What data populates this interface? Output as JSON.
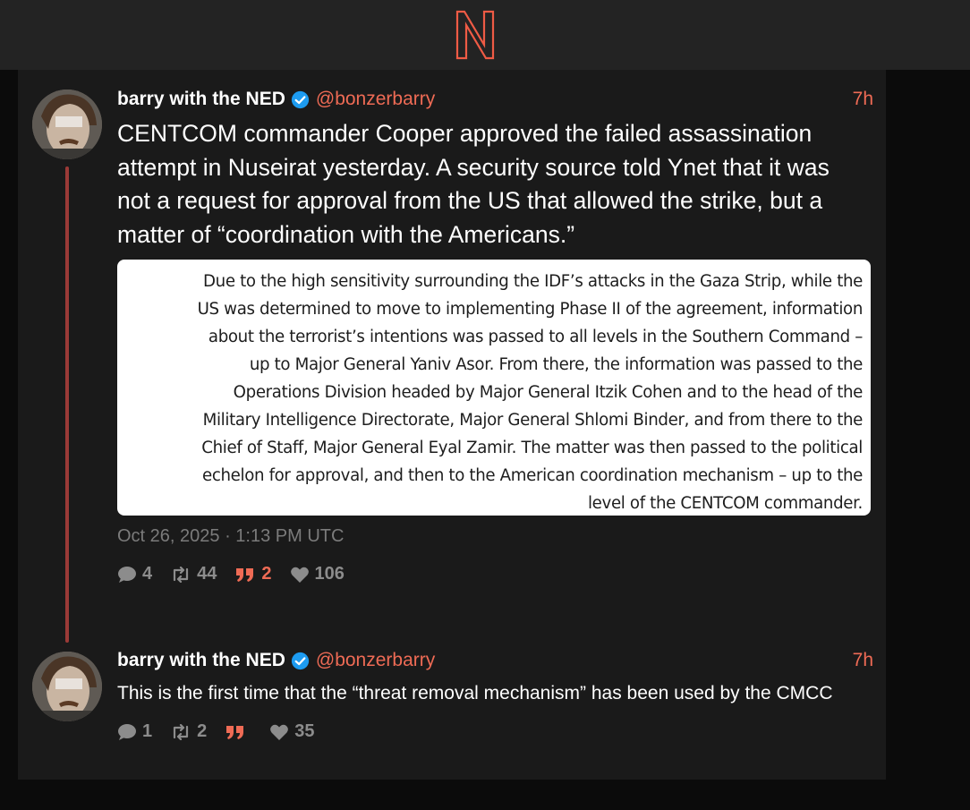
{
  "header": {
    "logo": "N"
  },
  "posts": [
    {
      "author": "barry with the NED",
      "handle": "@bonzerbarry",
      "time": "7h",
      "text": "CENTCOM commander Cooper approved the failed assassination attempt in Nuseirat yesterday. A security source told Ynet that it was not a request for approval from the US that allowed the strike, but a matter of “coordination with the Americans.”",
      "quote_lines": [
        "Due to the high sensitivity surrounding the IDF’s attacks in the Gaza Strip, while the",
        "US was determined to move to implementing Phase II of the agreement, information",
        "about the terrorist’s intentions was passed to all levels in the Southern Command –",
        "up to Major General Yaniv Asor. From there, the information was passed to the",
        "Operations Division headed by Major General Itzik Cohen and to the head of the",
        "Military Intelligence Directorate, Major General Shlomi Binder, and from there to the",
        "Chief of Staff, Major General Eyal Zamir. The matter was then passed to the political",
        "echelon for approval, and then to the American coordination mechanism – up to the",
        "level of the CENTCOM commander."
      ],
      "timestamp": "Oct 26, 2025 · 1:13 PM UTC",
      "stats": {
        "replies": "4",
        "reposts": "44",
        "quotes": "2",
        "likes": "106"
      }
    },
    {
      "author": "barry with the NED",
      "handle": "@bonzerbarry",
      "time": "7h",
      "text": "This is the first time that the “threat removal mechanism” has been used by the CMCC",
      "stats": {
        "replies": "1",
        "reposts": "2",
        "quotes": "",
        "likes": "35"
      }
    }
  ],
  "colors": {
    "accent": "#ef6b55",
    "thread_line": "#9b3a37",
    "verified": "#1d9bf0"
  },
  "icons": [
    "logo-n-icon",
    "verified-badge-icon",
    "reply-icon",
    "repost-icon",
    "quote-icon",
    "like-icon"
  ]
}
